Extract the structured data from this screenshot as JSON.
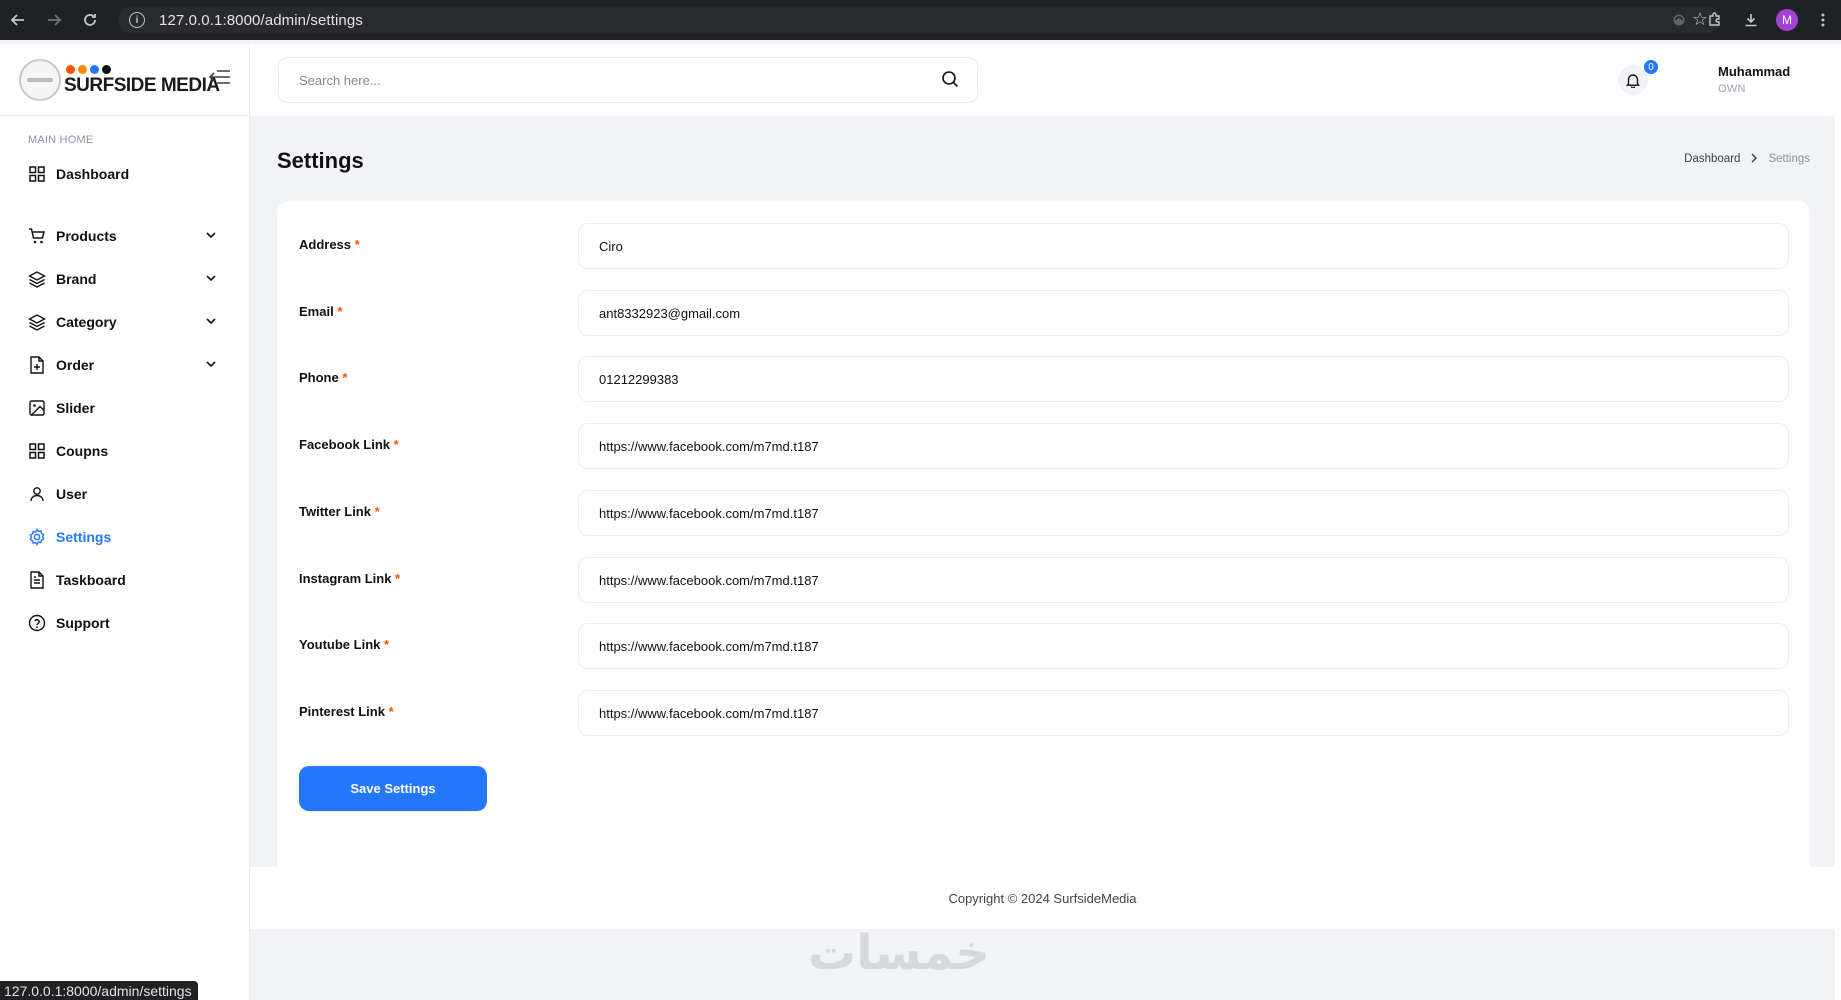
{
  "browser": {
    "url": "127.0.0.1:8000/admin/settings",
    "profile_initial": "M",
    "status_url": "127.0.0.1:8000/admin/settings"
  },
  "brand": {
    "logo_text": "SURFSIDE MEDIA",
    "dot_colors": [
      "#ff5200",
      "#ff8a00",
      "#2377fc",
      "#111111"
    ]
  },
  "sidebar": {
    "section_label": "MAIN HOME",
    "items": [
      {
        "label": "Dashboard",
        "icon": "grid-icon",
        "has_chevron": false
      },
      {
        "label": "Products",
        "icon": "cart-icon",
        "has_chevron": true
      },
      {
        "label": "Brand",
        "icon": "layers-icon",
        "has_chevron": true
      },
      {
        "label": "Category",
        "icon": "layers-icon",
        "has_chevron": true
      },
      {
        "label": "Order",
        "icon": "file-plus-icon",
        "has_chevron": true
      },
      {
        "label": "Slider",
        "icon": "image-icon",
        "has_chevron": false
      },
      {
        "label": "Coupns",
        "icon": "grid-icon",
        "has_chevron": false
      },
      {
        "label": "User",
        "icon": "user-icon",
        "has_chevron": false
      },
      {
        "label": "Settings",
        "icon": "gear-icon",
        "has_chevron": false,
        "active": true
      },
      {
        "label": "Taskboard",
        "icon": "file-text-icon",
        "has_chevron": false
      },
      {
        "label": "Support",
        "icon": "help-circle-icon",
        "has_chevron": false
      }
    ]
  },
  "header": {
    "search_placeholder": "Search here...",
    "notification_count": "0",
    "user_name": "Muhammad",
    "user_role": "OWN"
  },
  "page": {
    "title": "Settings",
    "breadcrumb": [
      "Dashboard",
      "Settings"
    ]
  },
  "form": {
    "fields": [
      {
        "label": "Address",
        "value": "Ciro"
      },
      {
        "label": "Email",
        "value": "ant8332923@gmail.com"
      },
      {
        "label": "Phone",
        "value": "01212299383"
      },
      {
        "label": "Facebook Link",
        "value": "https://www.facebook.com/m7md.t187"
      },
      {
        "label": "Twitter Link",
        "value": "https://www.facebook.com/m7md.t187"
      },
      {
        "label": "Instagram Link",
        "value": "https://www.facebook.com/m7md.t187"
      },
      {
        "label": "Youtube Link",
        "value": "https://www.facebook.com/m7md.t187"
      },
      {
        "label": "Pinterest Link",
        "value": "https://www.facebook.com/m7md.t187"
      }
    ],
    "required_mark": "*",
    "save_label": "Save Settings"
  },
  "footer": {
    "copyright": "Copyright © 2024 SurfsideMedia"
  },
  "watermark": "خمسات",
  "colors": {
    "accent": "#2377fc",
    "required": "#ff5200"
  }
}
